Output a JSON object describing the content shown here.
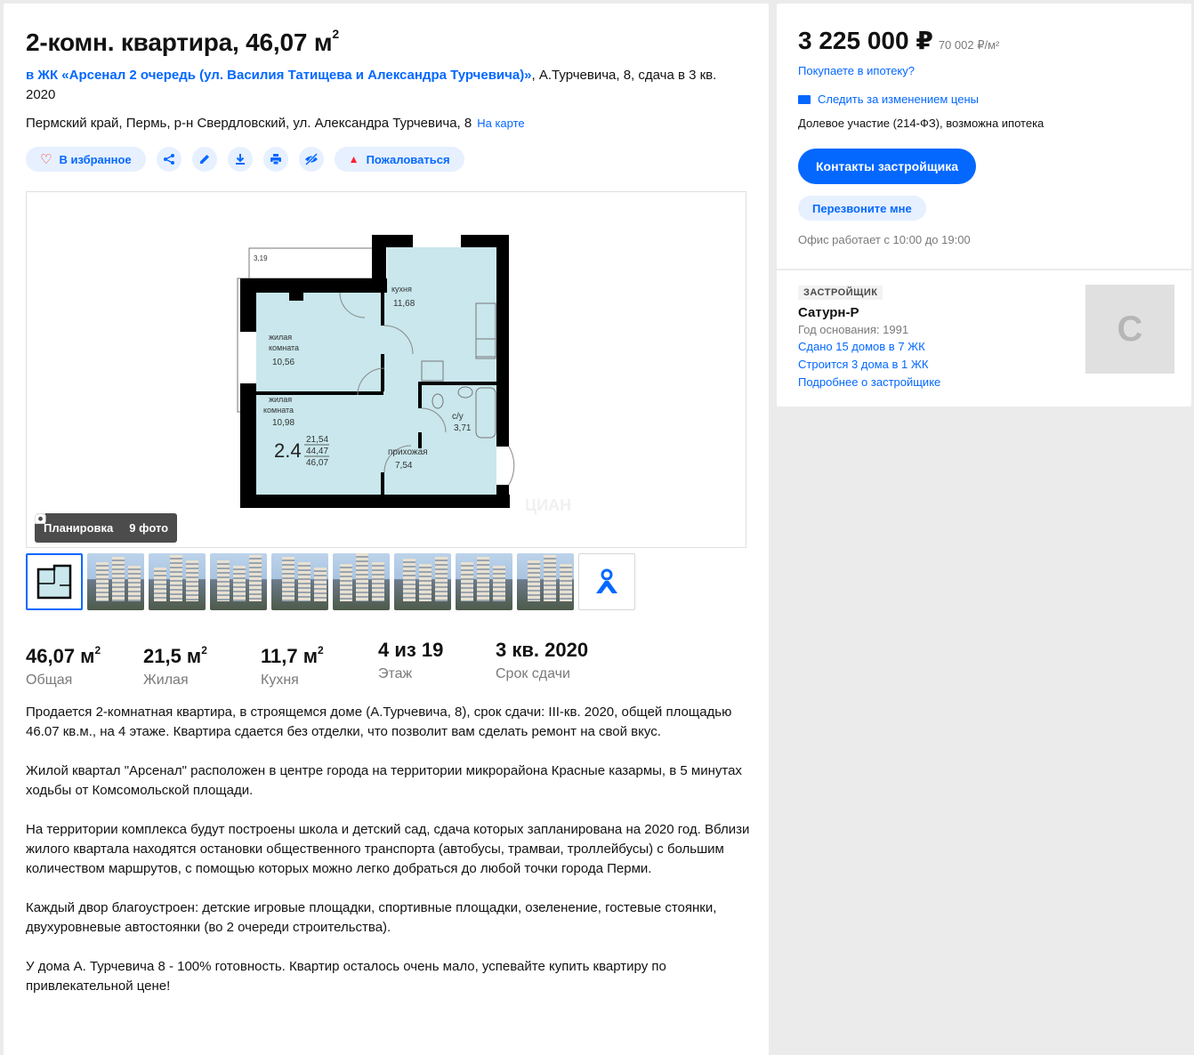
{
  "title": {
    "main": "2-комн. квартира, 46,07 м",
    "sup": "2"
  },
  "complex": {
    "link_text": "в ЖК «Арсенал 2 очередь (ул. Василия Татищева и Александра Турчевича)»",
    "suffix": ", А.Турчевича, 8, сдача в 3 кв. 2020"
  },
  "address": {
    "text": "Пермский край, Пермь, р-н Свердловский, ул. Александра Турчевича, 8",
    "map_link": "На карте"
  },
  "actions": {
    "favorite": "В избранное",
    "complain": "Пожаловаться"
  },
  "gallery": {
    "plan_label": "Планировка",
    "photos_label": "9 фото",
    "watermark": "ЦИАН",
    "rooms": {
      "balcony": "3,19",
      "kitchen_name": "кухня",
      "kitchen_area": "11,68",
      "room1_name1": "жилая",
      "room1_name2": "комната",
      "room1_area": "10,56",
      "room2_name1": "жилая",
      "room2_name2": "комната",
      "room2_area": "10,98",
      "bath_name": "с/у",
      "bath_area": "3,71",
      "hall_name": "прихожая",
      "hall_area": "7,54",
      "code": "2.4",
      "total1": "21,54",
      "total2": "44,47",
      "total3": "46,07"
    }
  },
  "facts": [
    {
      "value": "46,07 м",
      "sup": "2",
      "label": "Общая"
    },
    {
      "value": "21,5 м",
      "sup": "2",
      "label": "Жилая"
    },
    {
      "value": "11,7 м",
      "sup": "2",
      "label": "Кухня"
    },
    {
      "value": "4 из 19",
      "sup": "",
      "label": "Этаж"
    },
    {
      "value": "3 кв. 2020",
      "sup": "",
      "label": "Срок сдачи"
    }
  ],
  "description": [
    "Продается 2-комнатная квартира, в строящемся доме (А.Турчевича, 8), срок сдачи: III-кв. 2020, общей площадью 46.07 кв.м., на 4 этаже. Квартира сдается без отделки, что позволит вам сделать ремонт на свой вкус.",
    "Жилой квартал \"Арсенал\" расположен в центре города на территории микрорайона Красные казармы, в 5 минутах ходьбы от Комсомольской площади.",
    "На территории комплекса будут построены школа и детский сад, сдача которых запланирована на 2020 год. Вблизи жилого квартала находятся остановки общественного транспорта (автобусы, трамваи, троллейбусы) с большим количеством маршрутов, с помощью которых можно легко добраться до любой точки города Перми.",
    "Каждый двор благоустроен: детские игровые площадки, спортивные площадки, озеленение, гостевые стоянки, двухуровневые автостоянки (во 2 очереди строительства).",
    "У дома А. Турчевича 8 - 100% готовность. Квартир осталось очень мало, успевайте купить квартиру по привлекательной цене!"
  ],
  "sidebar": {
    "price": "3 225 000 ₽",
    "price_per_m": "70 002 ₽/м²",
    "mortgage_link": "Покупаете в ипотеку?",
    "watch_price": "Следить за изменением цены",
    "deal": "Долевое участие (214-ФЗ), возможна ипотека",
    "contacts_button": "Контакты застройщика",
    "callback_button": "Перезвоните мне",
    "office_hours": "Офис работает с 10:00 до 19:00"
  },
  "developer": {
    "tag": "ЗАСТРОЙЩИК",
    "name": "Сатурн-Р",
    "founded": "Год основания: 1991",
    "built": "Сдано 15 домов в 7 ЖК",
    "building": "Строится 3 дома в 1 ЖК",
    "more": "Подробнее о застройщике",
    "logo_letter": "С"
  },
  "colors": {
    "accent": "#0468ff",
    "accent_light": "#e6f0ff",
    "danger": "#ff1f34",
    "plan_fill": "#c9e7ec"
  }
}
